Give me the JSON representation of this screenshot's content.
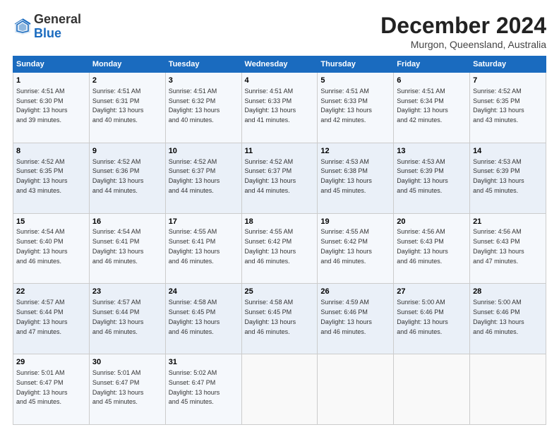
{
  "header": {
    "logo_line1": "General",
    "logo_line2": "Blue",
    "main_title": "December 2024",
    "subtitle": "Murgon, Queensland, Australia"
  },
  "calendar": {
    "days_of_week": [
      "Sunday",
      "Monday",
      "Tuesday",
      "Wednesday",
      "Thursday",
      "Friday",
      "Saturday"
    ],
    "weeks": [
      [
        {
          "day": "",
          "info": ""
        },
        {
          "day": "2",
          "info": "Sunrise: 4:51 AM\nSunset: 6:31 PM\nDaylight: 13 hours\nand 40 minutes."
        },
        {
          "day": "3",
          "info": "Sunrise: 4:51 AM\nSunset: 6:32 PM\nDaylight: 13 hours\nand 40 minutes."
        },
        {
          "day": "4",
          "info": "Sunrise: 4:51 AM\nSunset: 6:33 PM\nDaylight: 13 hours\nand 41 minutes."
        },
        {
          "day": "5",
          "info": "Sunrise: 4:51 AM\nSunset: 6:33 PM\nDaylight: 13 hours\nand 42 minutes."
        },
        {
          "day": "6",
          "info": "Sunrise: 4:51 AM\nSunset: 6:34 PM\nDaylight: 13 hours\nand 42 minutes."
        },
        {
          "day": "7",
          "info": "Sunrise: 4:52 AM\nSunset: 6:35 PM\nDaylight: 13 hours\nand 43 minutes."
        }
      ],
      [
        {
          "day": "1",
          "info": "Sunrise: 4:51 AM\nSunset: 6:30 PM\nDaylight: 13 hours\nand 39 minutes."
        },
        {
          "day": "",
          "info": ""
        },
        {
          "day": "",
          "info": ""
        },
        {
          "day": "",
          "info": ""
        },
        {
          "day": "",
          "info": ""
        },
        {
          "day": "",
          "info": ""
        },
        {
          "day": "",
          "info": ""
        }
      ],
      [
        {
          "day": "8",
          "info": "Sunrise: 4:52 AM\nSunset: 6:35 PM\nDaylight: 13 hours\nand 43 minutes."
        },
        {
          "day": "9",
          "info": "Sunrise: 4:52 AM\nSunset: 6:36 PM\nDaylight: 13 hours\nand 44 minutes."
        },
        {
          "day": "10",
          "info": "Sunrise: 4:52 AM\nSunset: 6:37 PM\nDaylight: 13 hours\nand 44 minutes."
        },
        {
          "day": "11",
          "info": "Sunrise: 4:52 AM\nSunset: 6:37 PM\nDaylight: 13 hours\nand 44 minutes."
        },
        {
          "day": "12",
          "info": "Sunrise: 4:53 AM\nSunset: 6:38 PM\nDaylight: 13 hours\nand 45 minutes."
        },
        {
          "day": "13",
          "info": "Sunrise: 4:53 AM\nSunset: 6:39 PM\nDaylight: 13 hours\nand 45 minutes."
        },
        {
          "day": "14",
          "info": "Sunrise: 4:53 AM\nSunset: 6:39 PM\nDaylight: 13 hours\nand 45 minutes."
        }
      ],
      [
        {
          "day": "15",
          "info": "Sunrise: 4:54 AM\nSunset: 6:40 PM\nDaylight: 13 hours\nand 46 minutes."
        },
        {
          "day": "16",
          "info": "Sunrise: 4:54 AM\nSunset: 6:41 PM\nDaylight: 13 hours\nand 46 minutes."
        },
        {
          "day": "17",
          "info": "Sunrise: 4:55 AM\nSunset: 6:41 PM\nDaylight: 13 hours\nand 46 minutes."
        },
        {
          "day": "18",
          "info": "Sunrise: 4:55 AM\nSunset: 6:42 PM\nDaylight: 13 hours\nand 46 minutes."
        },
        {
          "day": "19",
          "info": "Sunrise: 4:55 AM\nSunset: 6:42 PM\nDaylight: 13 hours\nand 46 minutes."
        },
        {
          "day": "20",
          "info": "Sunrise: 4:56 AM\nSunset: 6:43 PM\nDaylight: 13 hours\nand 46 minutes."
        },
        {
          "day": "21",
          "info": "Sunrise: 4:56 AM\nSunset: 6:43 PM\nDaylight: 13 hours\nand 47 minutes."
        }
      ],
      [
        {
          "day": "22",
          "info": "Sunrise: 4:57 AM\nSunset: 6:44 PM\nDaylight: 13 hours\nand 47 minutes."
        },
        {
          "day": "23",
          "info": "Sunrise: 4:57 AM\nSunset: 6:44 PM\nDaylight: 13 hours\nand 46 minutes."
        },
        {
          "day": "24",
          "info": "Sunrise: 4:58 AM\nSunset: 6:45 PM\nDaylight: 13 hours\nand 46 minutes."
        },
        {
          "day": "25",
          "info": "Sunrise: 4:58 AM\nSunset: 6:45 PM\nDaylight: 13 hours\nand 46 minutes."
        },
        {
          "day": "26",
          "info": "Sunrise: 4:59 AM\nSunset: 6:46 PM\nDaylight: 13 hours\nand 46 minutes."
        },
        {
          "day": "27",
          "info": "Sunrise: 5:00 AM\nSunset: 6:46 PM\nDaylight: 13 hours\nand 46 minutes."
        },
        {
          "day": "28",
          "info": "Sunrise: 5:00 AM\nSunset: 6:46 PM\nDaylight: 13 hours\nand 46 minutes."
        }
      ],
      [
        {
          "day": "29",
          "info": "Sunrise: 5:01 AM\nSunset: 6:47 PM\nDaylight: 13 hours\nand 45 minutes."
        },
        {
          "day": "30",
          "info": "Sunrise: 5:01 AM\nSunset: 6:47 PM\nDaylight: 13 hours\nand 45 minutes."
        },
        {
          "day": "31",
          "info": "Sunrise: 5:02 AM\nSunset: 6:47 PM\nDaylight: 13 hours\nand 45 minutes."
        },
        {
          "day": "",
          "info": ""
        },
        {
          "day": "",
          "info": ""
        },
        {
          "day": "",
          "info": ""
        },
        {
          "day": "",
          "info": ""
        }
      ]
    ]
  }
}
